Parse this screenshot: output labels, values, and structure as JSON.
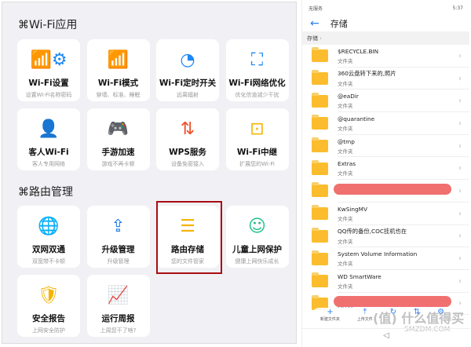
{
  "wifi_section": {
    "title": "Wi-Fi应用",
    "items": [
      {
        "title": "Wi-Fi设置",
        "sub": "设置Wi-Fi名称密码",
        "icon": "wifi-gear-icon"
      },
      {
        "title": "Wi-Fi模式",
        "sub": "穿墙、标准、睡眠",
        "icon": "wifi-icon"
      },
      {
        "title": "Wi-Fi定时开关",
        "sub": "远离辐射",
        "icon": "timer-icon"
      },
      {
        "title": "Wi-Fi网络优化",
        "sub": "优化信道减少干扰",
        "icon": "wifi-scan-icon"
      },
      {
        "title": "客人Wi-Fi",
        "sub": "客人专用网络",
        "icon": "guest-icon"
      },
      {
        "title": "手游加速",
        "sub": "游戏不再卡顿",
        "icon": "gamepad-icon"
      },
      {
        "title": "WPS服务",
        "sub": "设备免密接入",
        "icon": "wps-icon"
      },
      {
        "title": "Wi-Fi中继",
        "sub": "扩展您的Wi-Fi",
        "icon": "relay-icon"
      }
    ]
  },
  "router_section": {
    "title": "路由管理",
    "items": [
      {
        "title": "双网双通",
        "sub": "双宽带不卡顿",
        "icon": "globe-icon"
      },
      {
        "title": "升级管理",
        "sub": "升级管理",
        "icon": "router-upgrade-icon"
      },
      {
        "title": "路由存储",
        "sub": "您的文件管家",
        "icon": "storage-icon"
      },
      {
        "title": "儿童上网保护",
        "sub": "健康上网快乐成长",
        "icon": "child-icon"
      },
      {
        "title": "安全报告",
        "sub": "上网安全防护",
        "icon": "shield-icon"
      },
      {
        "title": "运行周报",
        "sub": "上周您干了啥?",
        "icon": "chart-icon"
      }
    ]
  },
  "phone": {
    "status_left": "无服务",
    "time": "5:37",
    "title": "存储",
    "breadcrumb": "存储",
    "type": "文件夹",
    "folders": [
      "$RECYCLE.BIN",
      "360云盘转下来的,照片",
      "@eaDir",
      "@quarantine",
      "@tmp",
      "Extras",
      "",
      "KwSingMV",
      "QQ传的备份,COC挂机也在",
      "System Volume Information",
      "WD SmartWare",
      ""
    ],
    "toolbar": [
      "新建文件夹",
      "上传文件"
    ]
  },
  "watermark": {
    "logo": "值",
    "text": "什么值得买",
    "site": "SMZDM.COM"
  },
  "colors": {
    "blue": "#1e88f5",
    "highlight": "#a80d12",
    "folder": "#fbbd2e"
  }
}
